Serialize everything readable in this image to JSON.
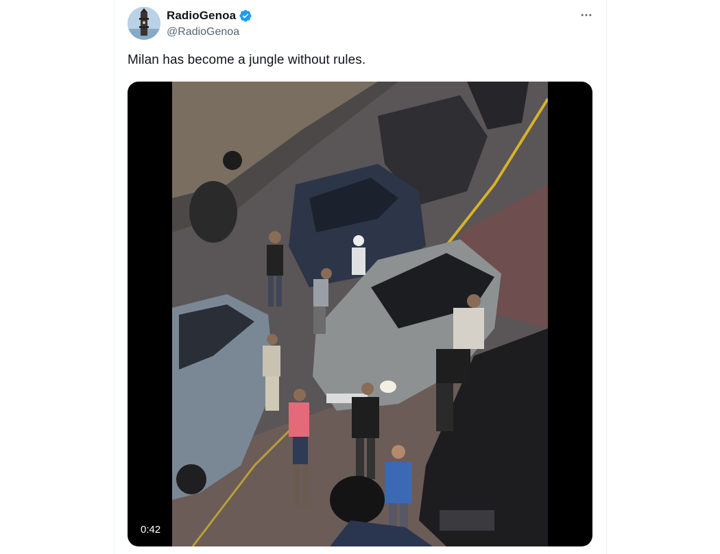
{
  "tweet": {
    "author_name": "RadioGenoa",
    "author_handle": "@RadioGenoa",
    "verified": true,
    "text": "Milan has become a jungle without rules.",
    "more_icon": "more-horizontal-icon"
  },
  "media": {
    "type": "video",
    "duration": "0:42",
    "description_icon": "video-thumbnail"
  },
  "colors": {
    "text_primary": "#0f1419",
    "text_secondary": "#536471",
    "verified_blue": "#1d9bf0",
    "border": "#eff3f4"
  }
}
